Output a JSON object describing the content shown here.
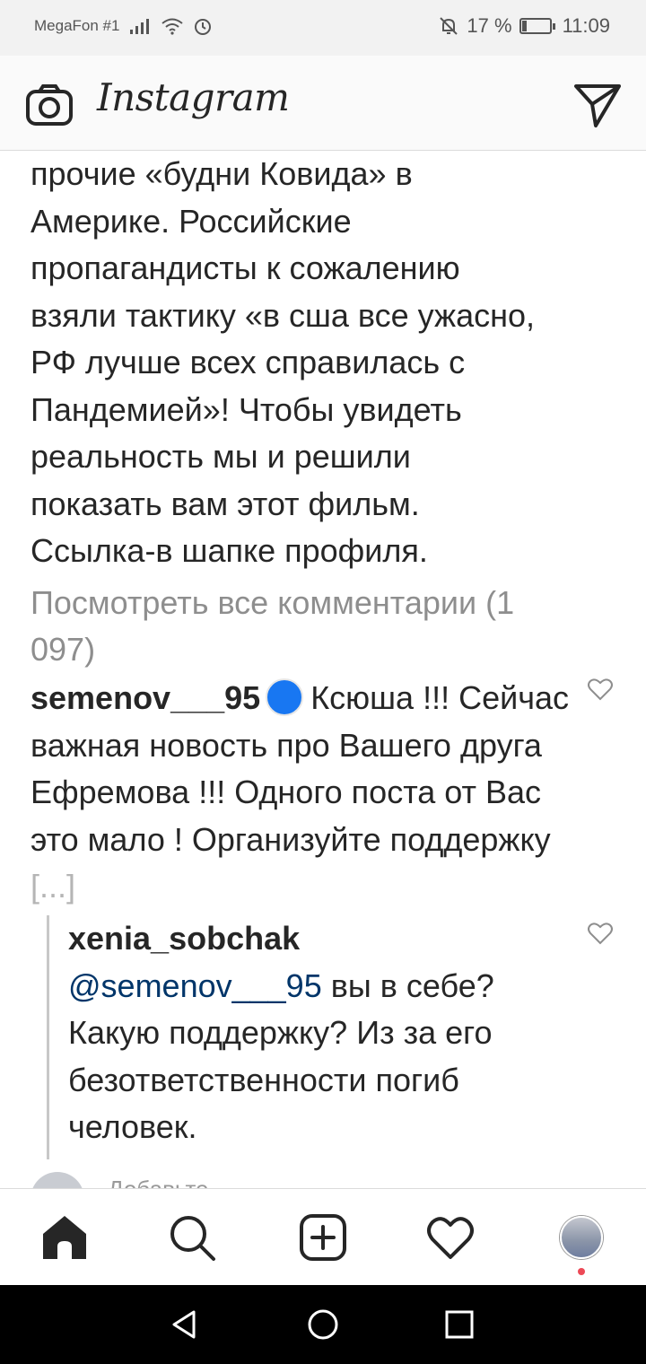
{
  "status_bar": {
    "carrier": "MegaFon #1",
    "battery_text": "17 %",
    "battery_level": 0.17,
    "time": "11:09"
  },
  "header": {
    "logo": "Instagram",
    "icons": [
      "camera-icon",
      "direct-message-icon"
    ]
  },
  "caption": {
    "lines": [
      "прочие «будни Ковида» в",
      "Америке. Российские",
      "пропагандисты к сожалению",
      "взяли тактику «в сша все ужасно,",
      "РФ лучше всех справилась с",
      "Пандемией»! Чтобы увидеть",
      "реальность мы и решили",
      "показать вам этот фильм.",
      "Ссылка-в шапке профиля."
    ]
  },
  "view_all_comments": "Посмотреть все комментарии (1 097)",
  "comment": {
    "username": "semenov___95",
    "text_first": "Ксюша !!!",
    "text_rest": "Сейчас важная новость про Вашего друга Ефремова !!! Одного поста от Вас это мало ! Организуйте поддержку",
    "more": "[...]"
  },
  "reply": {
    "username": "xenia_sobchak",
    "mention": "@semenov___95",
    "text": " вы в себе? Какую поддержку? Из за его безответственности погиб человек."
  },
  "add_comment": {
    "placeholder": "Добавьте"
  },
  "bottom_nav": {
    "items": [
      "home-icon",
      "search-icon",
      "new-post-icon",
      "activity-heart-icon",
      "profile-avatar"
    ]
  },
  "colors": {
    "text": "#262626",
    "muted": "#8e8e8e",
    "mention": "#003569",
    "blue_dot": "#1877f2",
    "notification": "#ed4956"
  }
}
